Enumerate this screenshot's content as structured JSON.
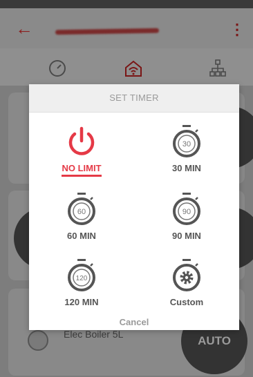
{
  "colors": {
    "accent": "#e53946",
    "icon_dark": "#555555",
    "muted": "#999999"
  },
  "header": {
    "back_icon": "back-arrow-icon",
    "menu_icon": "more-vert-icon"
  },
  "tabs": [
    {
      "icon": "gauge-icon"
    },
    {
      "icon": "home-wifi-icon"
    },
    {
      "icon": "network-icon"
    }
  ],
  "background_device": {
    "name": "Elec Boiler 5L",
    "mode": "AUTO"
  },
  "dialog": {
    "title": "SET TIMER",
    "options": [
      {
        "label": "NO LIMIT",
        "icon": "power-icon",
        "selected": true
      },
      {
        "label": "30 MIN",
        "icon": "stopwatch-icon",
        "value": "30"
      },
      {
        "label": "60 MIN",
        "icon": "stopwatch-icon",
        "value": "60"
      },
      {
        "label": "90 MIN",
        "icon": "stopwatch-icon",
        "value": "90"
      },
      {
        "label": "120 MIN",
        "icon": "stopwatch-icon",
        "value": "120"
      },
      {
        "label": "Custom",
        "icon": "gear-stopwatch-icon"
      }
    ],
    "cancel_label": "Cancel"
  }
}
